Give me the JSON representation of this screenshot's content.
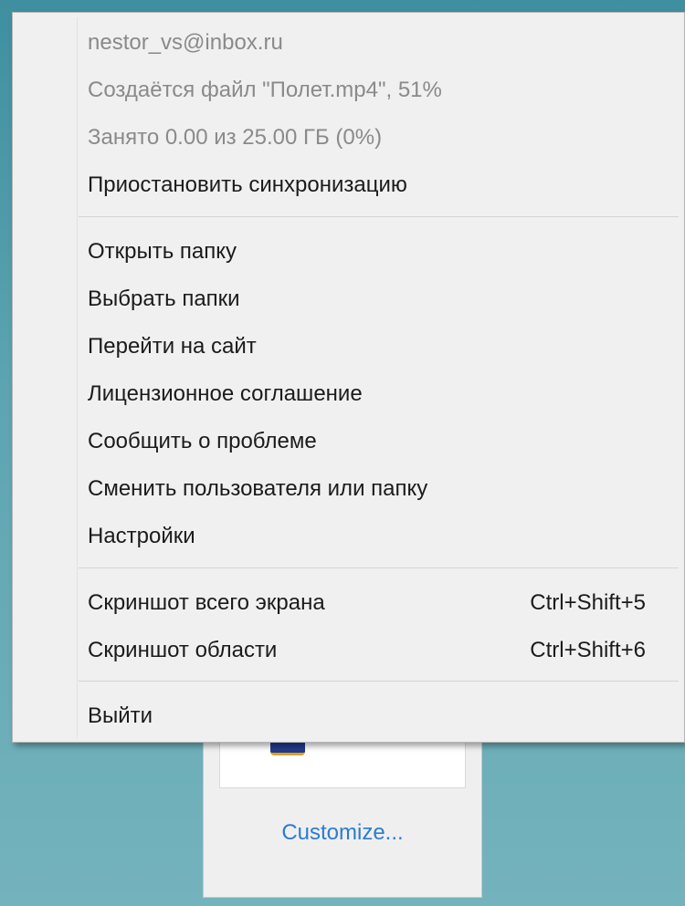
{
  "menu": {
    "info": {
      "account": "nestor_vs@inbox.ru",
      "upload_status": "Создаётся файл \"Полет.mp4\", 51%",
      "storage": "Занято 0.00 из 25.00 ГБ (0%)"
    },
    "pause_sync": "Приостановить синхронизацию",
    "open_folder": "Открыть папку",
    "choose_folders": "Выбрать папки",
    "go_to_site": "Перейти на сайт",
    "license": "Лицензионное соглашение",
    "report_problem": "Сообщить о проблеме",
    "change_user": "Сменить пользователя или папку",
    "settings": "Настройки",
    "screenshot_full": {
      "label": "Скриншот всего экрана",
      "shortcut": "Ctrl+Shift+5"
    },
    "screenshot_area": {
      "label": "Скриншот области",
      "shortcut": "Ctrl+Shift+6"
    },
    "exit": "Выйти"
  },
  "tray": {
    "customize_label": "Customize..."
  }
}
